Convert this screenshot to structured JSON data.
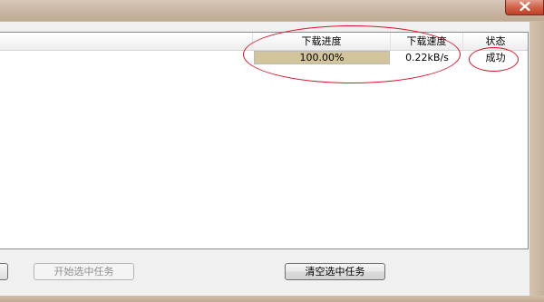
{
  "columns": {
    "progress": "下载进度",
    "speed": "下载速度",
    "status": "状态"
  },
  "task": {
    "progress_fraction": 1.0,
    "progress_text": "100.00%",
    "speed": "0.22kB/s",
    "status": "成功"
  },
  "buttons": {
    "start_selected": "开始选中任务",
    "clear_selected": "清空选中任务"
  },
  "colors": {
    "progress_fill": "#d2c59b",
    "annotation_red": "#d9152b"
  }
}
